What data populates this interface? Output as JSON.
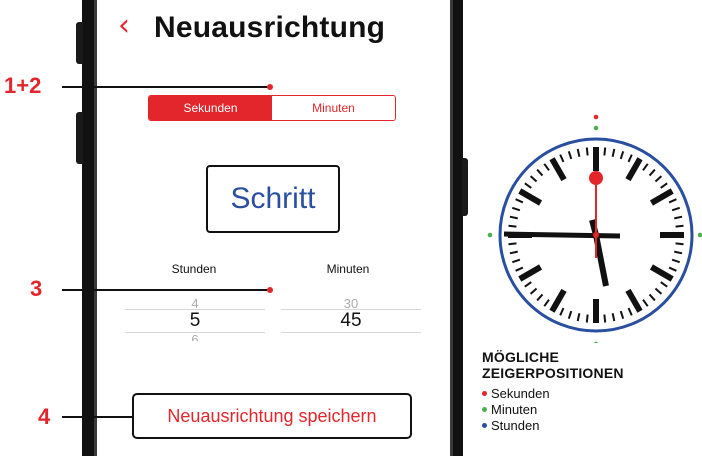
{
  "header": {
    "back_glyph": "‹",
    "title": "Neuausrichtung"
  },
  "segmented": {
    "options": [
      "Sekunden",
      "Minuten"
    ],
    "selected": "Sekunden"
  },
  "step_button": {
    "label": "Schritt"
  },
  "pickers": {
    "hours": {
      "label": "Stunden",
      "prev": "4",
      "value": "5",
      "next": "6"
    },
    "minutes": {
      "label": "Minuten",
      "prev": "30",
      "value": "45",
      "next": ""
    }
  },
  "save_button": {
    "label": "Neuausrichtung speichern"
  },
  "callouts": [
    "1+2",
    "3",
    "4"
  ],
  "legend": {
    "title_line1": "MÖGLICHE",
    "title_line2": "ZEIGERPOSITIONEN",
    "items": [
      {
        "label": "Sekunden",
        "color": "#e2262b"
      },
      {
        "label": "Minuten",
        "color": "#4caf50"
      },
      {
        "label": "Stunden",
        "color": "#2a4fa0"
      }
    ]
  },
  "colors": {
    "accent": "#e2262b",
    "clock_ring": "#2a4fa0",
    "marker_green": "#4caf50",
    "text": "#111111"
  }
}
